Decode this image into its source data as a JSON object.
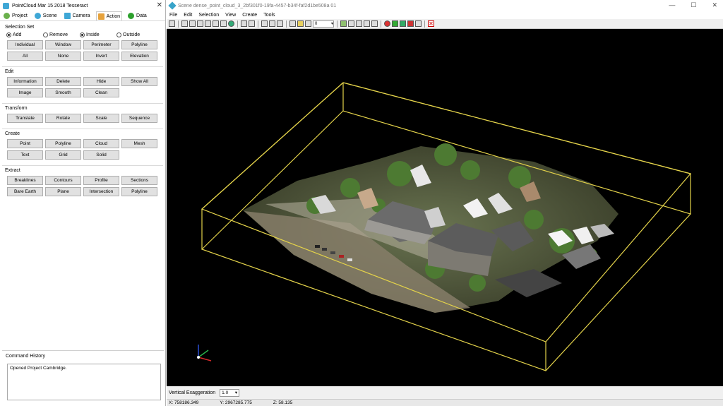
{
  "left_panel": {
    "title": "PointCloud Mar 15 2018 Tesseract",
    "tabs": [
      {
        "label": "Project",
        "color": "#6ab04c"
      },
      {
        "label": "Scene",
        "color": "#3fa7d6"
      },
      {
        "label": "Camera",
        "color": "#3fa7d6"
      },
      {
        "label": "Action",
        "color": "#e6a23c"
      },
      {
        "label": "Data",
        "color": "#2ca02c"
      }
    ],
    "selection_set": {
      "title": "Selection Set",
      "radios": [
        {
          "label": "Add",
          "checked": true
        },
        {
          "label": "Remove",
          "checked": false
        },
        {
          "label": "Inside",
          "checked": true
        },
        {
          "label": "Outside",
          "checked": false
        }
      ],
      "buttons": [
        "Individual",
        "Window",
        "Perimeter",
        "Polyline",
        "All",
        "None",
        "Invert",
        "Elevation"
      ]
    },
    "edit": {
      "title": "Edit",
      "buttons": [
        "Information",
        "Delete",
        "Hide",
        "Show All",
        "Image",
        "Smooth",
        "Clean"
      ]
    },
    "transform": {
      "title": "Transform",
      "buttons": [
        "Translate",
        "Rotate",
        "Scale",
        "Sequence"
      ]
    },
    "create": {
      "title": "Create",
      "buttons": [
        "Point",
        "Polyline",
        "Cloud",
        "Mesh",
        "Text",
        "Grid",
        "Solid"
      ]
    },
    "extract": {
      "title": "Extract",
      "buttons": [
        "Breaklines",
        "Contours",
        "Profile",
        "Sections",
        "Bare Earth",
        "Plane",
        "Intersection",
        "Polyline"
      ]
    },
    "command_history": {
      "title": "Command History",
      "text": "Opened Project Cambridge."
    }
  },
  "scene": {
    "title": "Scene dense_point_cloud_3_2bf301f0-19fa-4457-b34f-faf2d1be508a 01",
    "window_controls": [
      "—",
      "☐",
      "✕"
    ],
    "menu": [
      "File",
      "Edit",
      "Selection",
      "View",
      "Create",
      "Tools"
    ],
    "toolbar_select_value": "0",
    "vertical_exaggeration_label": "Vertical Exaggeration",
    "vertical_exaggeration_value": "1.0",
    "status": {
      "x": "X: 758186.349",
      "y": "Y: 2967285.775",
      "z": "Z: 58.135"
    },
    "bbox_color": "#e3d24a"
  }
}
